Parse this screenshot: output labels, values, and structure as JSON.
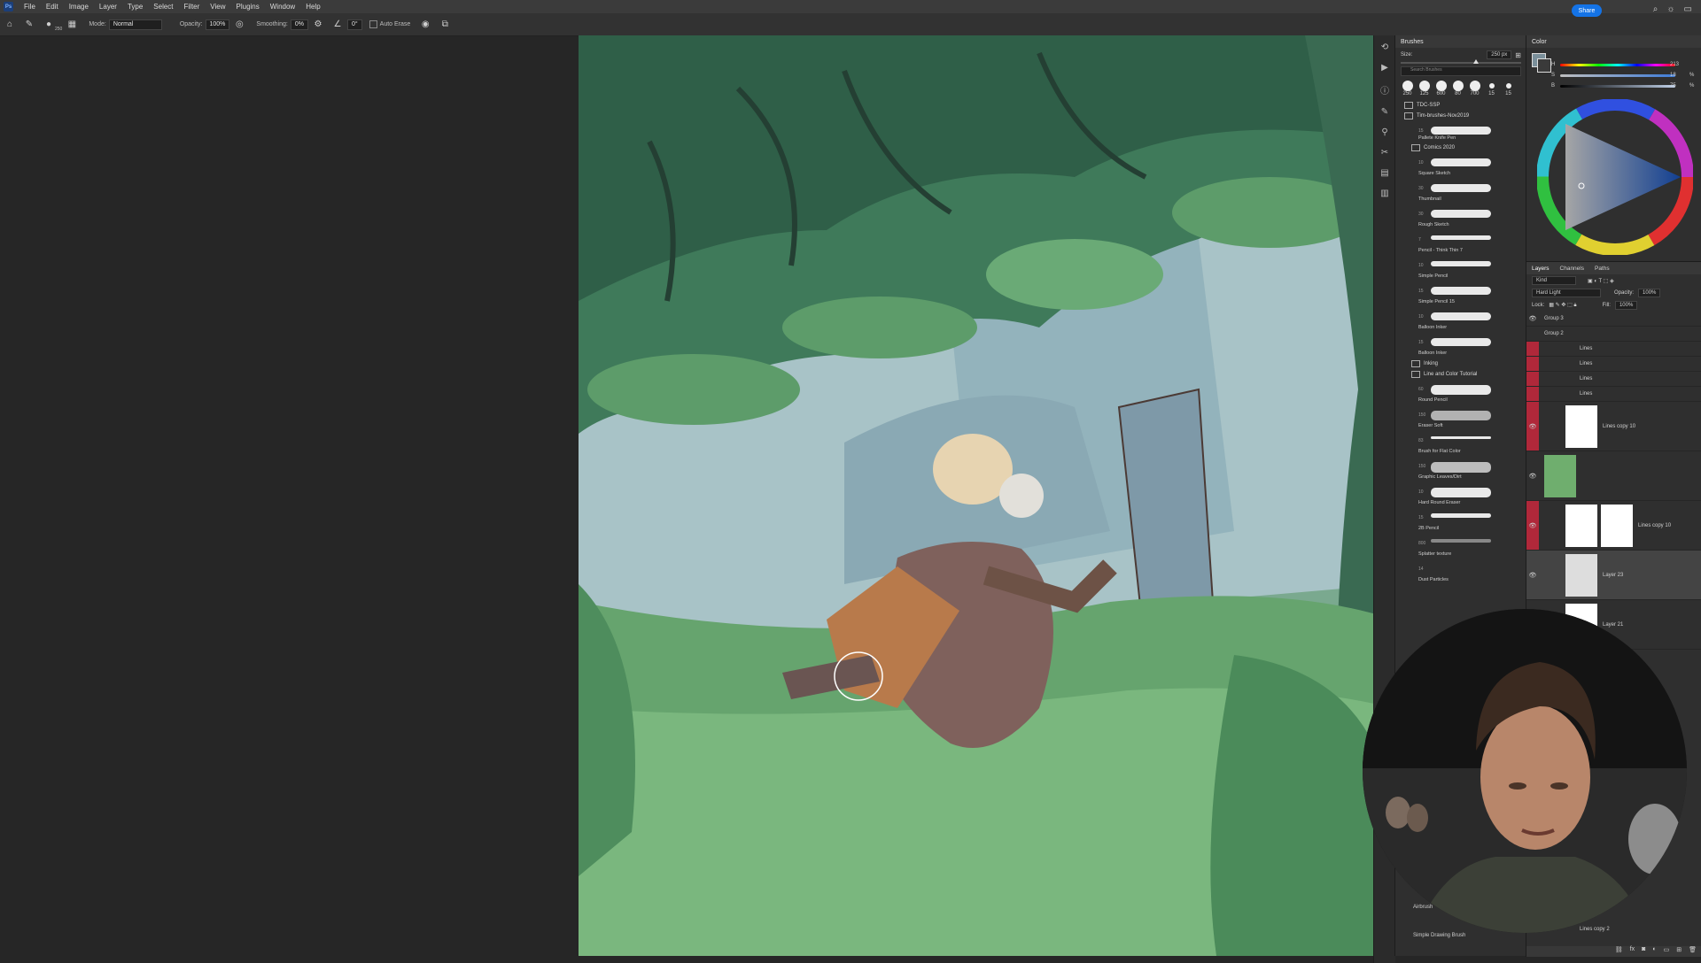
{
  "menubar": {
    "logo": "Ps",
    "items": [
      "File",
      "Edit",
      "Image",
      "Layer",
      "Type",
      "Select",
      "Filter",
      "View",
      "Plugins",
      "Window",
      "Help"
    ]
  },
  "options": {
    "brush_size": "250",
    "mode_label": "Mode:",
    "mode_value": "Normal",
    "opacity_label": "Opacity:",
    "opacity_value": "100%",
    "smoothing_label": "Smoothing:",
    "smoothing_value": "0%",
    "angle_value": "0°",
    "auto_erase_label": "Auto Erase"
  },
  "share_label": "Share",
  "brushes_panel": {
    "title": "Brushes",
    "size_label": "Size:",
    "size_value": "250 px",
    "search_placeholder": "Search Brushes",
    "presets": [
      "250",
      "125",
      "600",
      "80",
      "700",
      "15",
      "15"
    ],
    "folders": [
      "TDC-SSP",
      "Tim-brushes-Nov2019",
      "Comics 2020",
      "Inking",
      "Line and Color Tutorial"
    ],
    "brushes": [
      {
        "size": "15",
        "name": "Pallete Knife Pen"
      },
      {
        "size": "10",
        "name": "Square Sketch"
      },
      {
        "size": "30",
        "name": "Thumbnail"
      },
      {
        "size": "30",
        "name": "Rough Sketch"
      },
      {
        "size": "7",
        "name": "Pencil - Think Thin 7"
      },
      {
        "size": "10",
        "name": "Simple Pencil"
      },
      {
        "size": "15",
        "name": "Simple Pencil 15"
      },
      {
        "size": "10",
        "name": "Balloon Inker"
      },
      {
        "size": "15",
        "name": "Balloon Inker"
      },
      {
        "size": "60",
        "name": "Round Pencil"
      },
      {
        "size": "150",
        "name": "Eraser Soft"
      },
      {
        "size": "83",
        "name": "Brush for Flat Color"
      },
      {
        "size": "150",
        "name": "Graphic Leaves/Dirt"
      },
      {
        "size": "10",
        "name": "Hard Round Eraser"
      },
      {
        "size": "15",
        "name": "2B Pencil"
      },
      {
        "size": "800",
        "name": "Splatter texture"
      },
      {
        "size": "14",
        "name": "Dust Particles"
      }
    ],
    "bottom_brushes": [
      "Airbrush",
      "Simple Drawing Brush"
    ]
  },
  "color_panel": {
    "title": "Color",
    "h_label": "H",
    "s_label": "S",
    "b_label": "B",
    "h_value": "213",
    "s_value": "18",
    "b_value": "75",
    "percent": "%"
  },
  "layers_panel": {
    "tabs": [
      "Layers",
      "Channels",
      "Paths"
    ],
    "kind_label": "Kind",
    "blend_mode": "Hard Light",
    "opacity_label": "Opacity:",
    "opacity_value": "100%",
    "lock_label": "Lock:",
    "fill_label": "Fill:",
    "fill_value": "100%",
    "groups": [
      "Group 3",
      "Group 2"
    ],
    "sublayers": [
      "Lines",
      "Lines",
      "Lines",
      "Lines"
    ],
    "layers": [
      "Lines copy 10",
      "",
      "Lines copy 10",
      "Layer 23",
      "Layer 21"
    ],
    "bottom_layer": "Lines copy 2"
  },
  "colors": {
    "accent": "#1473e6",
    "red_mark": "#b0283a",
    "bg_panel": "#2f2f2f"
  }
}
